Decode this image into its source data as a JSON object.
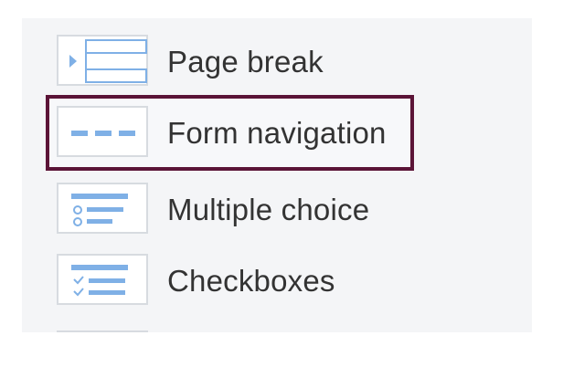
{
  "menu": {
    "items": [
      {
        "label": "Page break",
        "icon": "page-break-icon",
        "selected": false
      },
      {
        "label": "Form navigation",
        "icon": "form-navigation-icon",
        "selected": true
      },
      {
        "label": "Multiple choice",
        "icon": "multiple-choice-icon",
        "selected": false
      },
      {
        "label": "Checkboxes",
        "icon": "checkboxes-icon",
        "selected": false
      }
    ]
  },
  "colors": {
    "panel_bg": "#f4f5f7",
    "highlight_border": "#5b1437",
    "icon_accent": "#7fb0e6",
    "thumb_border": "#d7dbe0",
    "label_text": "#333333"
  }
}
